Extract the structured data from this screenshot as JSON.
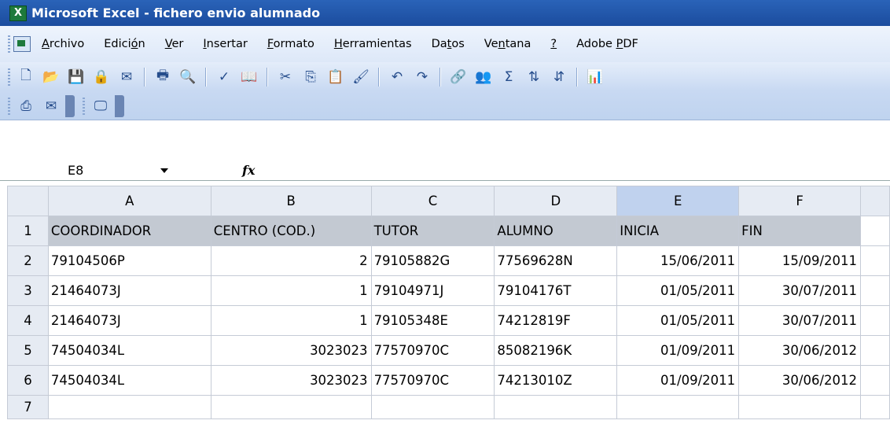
{
  "window": {
    "title": "Microsoft Excel - fichero envio alumnado",
    "app_icon": "excel-icon"
  },
  "menu": [
    {
      "pre": "",
      "u": "A",
      "post": "rchivo"
    },
    {
      "pre": "Edici",
      "u": "ó",
      "post": "n"
    },
    {
      "pre": "",
      "u": "V",
      "post": "er"
    },
    {
      "pre": "",
      "u": "I",
      "post": "nsertar"
    },
    {
      "pre": "",
      "u": "F",
      "post": "ormato"
    },
    {
      "pre": "",
      "u": "H",
      "post": "erramientas"
    },
    {
      "pre": "Da",
      "u": "t",
      "post": "os"
    },
    {
      "pre": "Ve",
      "u": "n",
      "post": "tana"
    },
    {
      "pre": "",
      "u": "?",
      "post": ""
    },
    {
      "pre": "Adobe ",
      "u": "P",
      "post": "DF"
    }
  ],
  "toolbar": {
    "standard": [
      {
        "name": "new-icon",
        "glyph": "🗋"
      },
      {
        "name": "open-icon",
        "glyph": "📂"
      },
      {
        "name": "save-icon",
        "glyph": "💾"
      },
      {
        "name": "permission-icon",
        "glyph": "🔒"
      },
      {
        "name": "email-icon",
        "glyph": "✉"
      },
      {
        "sep": true
      },
      {
        "name": "print-icon",
        "glyph": "🖶"
      },
      {
        "name": "print-preview-icon",
        "glyph": "🔍"
      },
      {
        "sep": true
      },
      {
        "name": "spelling-icon",
        "glyph": "✓"
      },
      {
        "name": "research-icon",
        "glyph": "📖"
      },
      {
        "sep": true
      },
      {
        "name": "cut-icon",
        "glyph": "✂"
      },
      {
        "name": "copy-icon",
        "glyph": "⎘"
      },
      {
        "name": "paste-icon",
        "glyph": "📋"
      },
      {
        "name": "format-painter-icon",
        "glyph": "🖌"
      },
      {
        "sep": true
      },
      {
        "name": "undo-icon",
        "glyph": "↶"
      },
      {
        "name": "redo-icon",
        "glyph": "↷"
      },
      {
        "sep": true
      },
      {
        "name": "hyperlink-icon",
        "glyph": "🔗"
      },
      {
        "name": "users-icon",
        "glyph": "👥"
      },
      {
        "name": "autosum-icon",
        "glyph": "Σ"
      },
      {
        "name": "sort-asc-icon",
        "glyph": "⇅"
      },
      {
        "name": "sort-desc-icon",
        "glyph": "⇵"
      },
      {
        "sep": true
      },
      {
        "name": "chart-icon",
        "glyph": "📊"
      }
    ],
    "pdf": [
      {
        "name": "pdf-convert-icon",
        "glyph": "⎙"
      },
      {
        "name": "pdf-email-icon",
        "glyph": "✉"
      }
    ],
    "extra": [
      {
        "name": "acrobat-icon",
        "glyph": "🖵"
      }
    ]
  },
  "formula_bar": {
    "name_box": "E8",
    "fx_label": "fx",
    "value": ""
  },
  "sheet": {
    "columns": [
      "A",
      "B",
      "C",
      "D",
      "E",
      "F"
    ],
    "selected_column": "E",
    "header": [
      "COORDINADOR",
      "CENTRO (COD.)",
      "TUTOR",
      "ALUMNO",
      "INICIA",
      "FIN"
    ],
    "rows": [
      [
        "79104506P",
        "2",
        "79105882G",
        "77569628N",
        "15/06/2011",
        "15/09/2011"
      ],
      [
        "21464073J",
        "1",
        "79104971J",
        "79104176T",
        "01/05/2011",
        "30/07/2011"
      ],
      [
        "21464073J",
        "1",
        "79105348E",
        "74212819F",
        "01/05/2011",
        "30/07/2011"
      ],
      [
        "74504034L",
        "3023023",
        "77570970C",
        "85082196K",
        "01/09/2011",
        "30/06/2012"
      ],
      [
        "74504034L",
        "3023023",
        "77570970C",
        "74213010Z",
        "01/09/2011",
        "30/06/2012"
      ]
    ],
    "row_numbers": [
      "1",
      "2",
      "3",
      "4",
      "5",
      "6",
      "7"
    ]
  }
}
